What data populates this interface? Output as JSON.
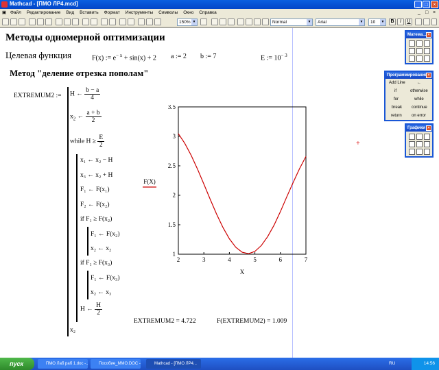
{
  "window": {
    "title": "Mathcad - [ПМО ЛР4.mcd]"
  },
  "menu": [
    "Файл",
    "Редактирование",
    "Вид",
    "Вставить",
    "Формат",
    "Инструменты",
    "Символы",
    "Окно",
    "Справка"
  ],
  "toolbar": {
    "zoom": "150%",
    "style": "Normal",
    "font": "Arial",
    "size": "10"
  },
  "sheet": {
    "heading": "Методы одномерной оптимизации",
    "target_label": "Целевая функция",
    "fx": "F(x) := e",
    "fx_exp": "− x",
    "fx_rest": "+ sin(x) + 2",
    "a_def": "a := 2",
    "b_def": "b := 7",
    "e_def": "E := 10",
    "e_exp": "− 3",
    "method": "Метод  \"деление отрезка пополам\"",
    "program_name": "EXTREMUM2 :=",
    "lines": {
      "h_assign": "H ←",
      "h_num": "b − a",
      "h_den": "4",
      "x2_assign": "x",
      "x2_sub": "2",
      "x2_arrow": "←",
      "x2_num": "a + b",
      "x2_den": "2",
      "while": "while H ≥",
      "while_num": "E",
      "while_den": "2",
      "l1": "x₁ ← x₂ − H",
      "l2": "x₃ ← x₂ + H",
      "l3": "F₁ ← F(x₁)",
      "l4": "F₂ ← F(x₂)",
      "if1": "if  F₁ ≥ F(x₂)",
      "if1a": "F₁ ← F(x₂)",
      "if1b": "x₂ ← x₂",
      "if2": "if  F₁ ≥ F(x₃)",
      "if2a": "F₁ ← F(x₃)",
      "if2b": "x₂ ← x₃",
      "hh": "H ←",
      "hh_num": "H",
      "hh_den": "2",
      "ret": "x₂"
    },
    "result1": "EXTREMUM2 = 4.722",
    "result2": "F(EXTREMUM2) = 1.009"
  },
  "chart_data": {
    "type": "line",
    "ylabel": "F(X)",
    "xlabel": "X",
    "xlim": [
      2,
      7
    ],
    "ylim": [
      1,
      3.5
    ],
    "xticks": [
      "2",
      "3",
      "4",
      "5",
      "6",
      "7"
    ],
    "yticks": [
      "1",
      "1.5",
      "2",
      "2.5",
      "3",
      "3.5"
    ],
    "series": [
      {
        "color": "#cc0000",
        "x": [
          2,
          2.25,
          2.5,
          2.75,
          3,
          3.25,
          3.5,
          3.75,
          4,
          4.25,
          4.5,
          4.75,
          5,
          5.25,
          5.5,
          5.75,
          6,
          6.25,
          6.5,
          6.75,
          7
        ],
        "y": [
          3.045,
          2.883,
          2.68,
          2.445,
          2.191,
          1.93,
          1.679,
          1.452,
          1.262,
          1.119,
          1.034,
          1.009,
          1.048,
          1.147,
          1.299,
          1.492,
          1.723,
          1.974,
          2.217,
          2.452,
          2.658
        ]
      }
    ]
  },
  "palettes": {
    "math": {
      "title": "Матема..."
    },
    "programming": {
      "title": "Программирование",
      "items": [
        "Add Line",
        "←",
        "if",
        "otherwise",
        "for",
        "while",
        "break",
        "continue",
        "return",
        "on error"
      ]
    },
    "graphs": {
      "title": "Графики"
    }
  },
  "taskbar": {
    "start": "пуск",
    "tasks": [
      "ПМО Лаб раб 1.doc -...",
      "Пособие_ММО.DOC -...",
      "Mathcad - [ПМО ЛР4..."
    ],
    "lang": "RU",
    "clock": "14:56"
  }
}
